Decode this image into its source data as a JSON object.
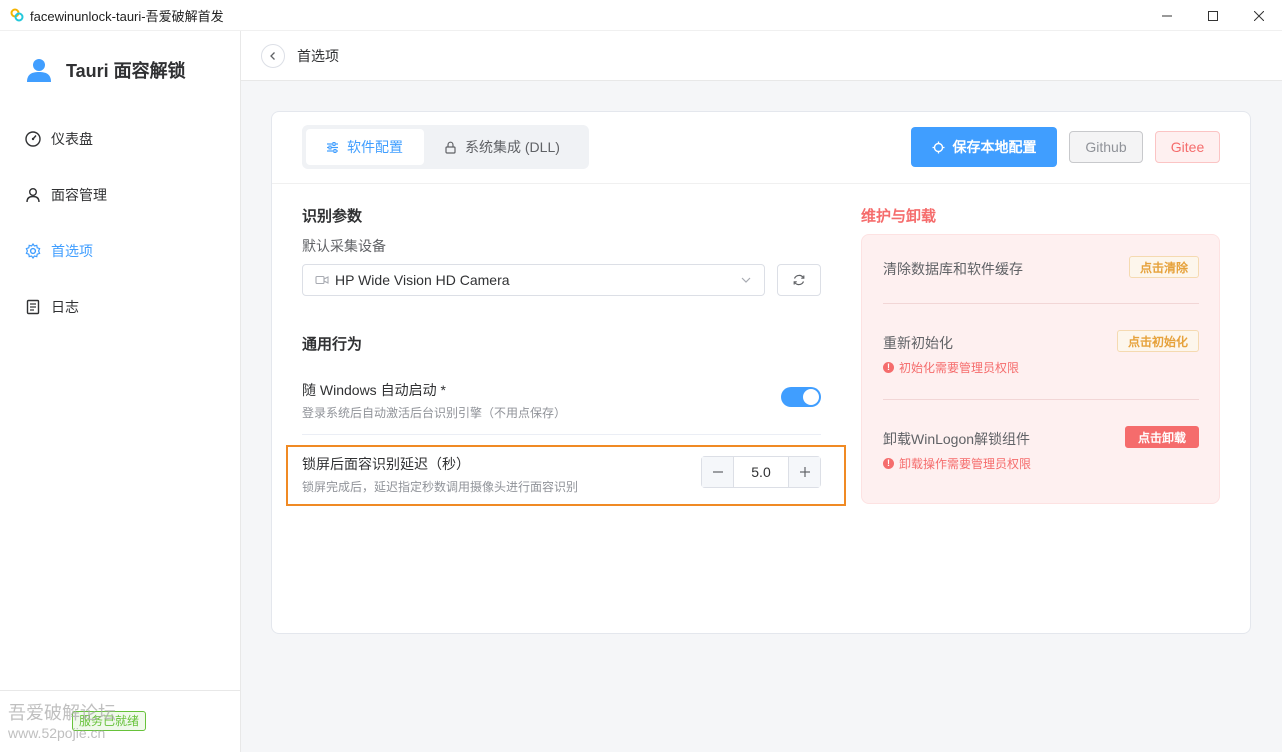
{
  "window": {
    "title": "facewinunlock-tauri-吾爱破解首发"
  },
  "sidebar": {
    "brand": "Tauri 面容解锁",
    "items": [
      {
        "label": "仪表盘",
        "icon": "dashboard-icon"
      },
      {
        "label": "面容管理",
        "icon": "user-icon"
      },
      {
        "label": "首选项",
        "icon": "gear-icon",
        "active": true
      },
      {
        "label": "日志",
        "icon": "document-icon"
      }
    ],
    "status": "服务已就绪",
    "watermark_line1": "吾爱破解论坛",
    "watermark_line2": "www.52pojie.cn"
  },
  "header": {
    "title": "首选项"
  },
  "tabs": [
    {
      "label": "软件配置",
      "active": true
    },
    {
      "label": "系统集成 (DLL)",
      "active": false
    }
  ],
  "actions": {
    "save": "保存本地配置",
    "github": "Github",
    "gitee": "Gitee"
  },
  "recognition": {
    "title": "识别参数",
    "device_label": "默认采集设备",
    "device_value": "HP Wide Vision HD Camera"
  },
  "behavior": {
    "title": "通用行为",
    "autostart_title": "随 Windows 自动启动 *",
    "autostart_desc": "登录系统后自动激活后台识别引擎（不用点保存）",
    "autostart_on": true,
    "delay_title": "锁屏后面容识别延迟（秒）",
    "delay_desc": "锁屏完成后，延迟指定秒数调用摄像头进行面容识别",
    "delay_value": "5.0"
  },
  "maintenance": {
    "title": "维护与卸载",
    "clear_label": "清除数据库和软件缓存",
    "clear_btn": "点击清除",
    "reinit_label": "重新初始化",
    "reinit_btn": "点击初始化",
    "reinit_note": "初始化需要管理员权限",
    "uninstall_label": "卸载WinLogon解锁组件",
    "uninstall_btn": "点击卸载",
    "uninstall_note": "卸载操作需要管理员权限"
  },
  "colors": {
    "primary": "#409eff",
    "danger": "#f56c6c",
    "warning": "#e6a23c",
    "success": "#67c23a"
  }
}
